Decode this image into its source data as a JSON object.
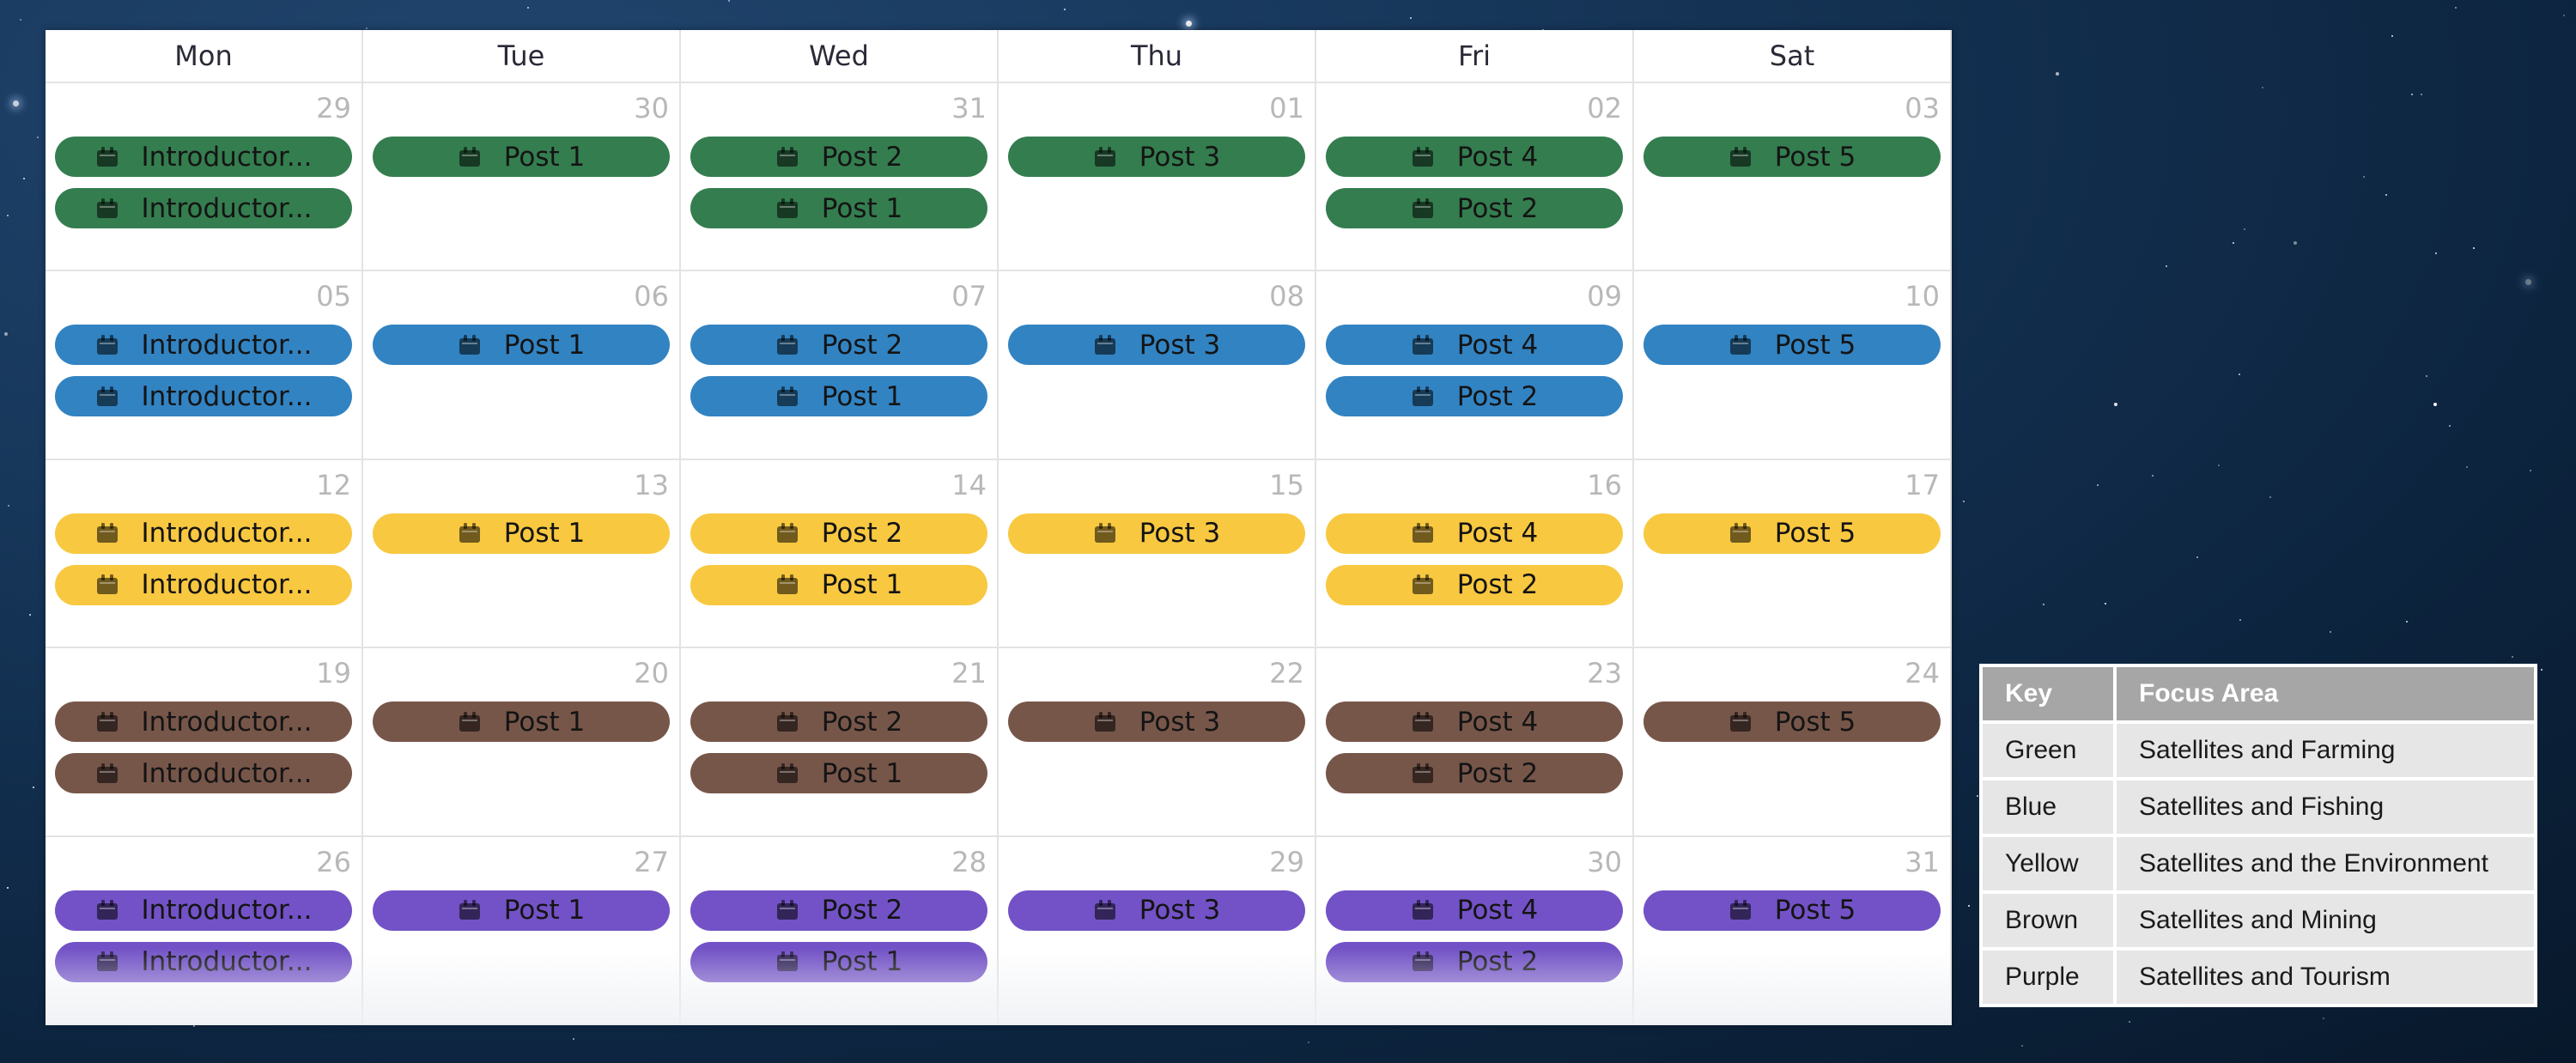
{
  "calendar": {
    "days": [
      "Mon",
      "Tue",
      "Wed",
      "Thu",
      "Fri",
      "Sat"
    ],
    "event_icon": "calendar-event-icon",
    "colors": {
      "green": "#347d4f",
      "blue": "#3283c2",
      "yellow": "#f8c840",
      "brown": "#77564a",
      "purple": "#7252c6"
    },
    "weeks": [
      {
        "color": "green",
        "cells": [
          {
            "date": "29",
            "events": [
              "Introductor...",
              "Introductor..."
            ]
          },
          {
            "date": "30",
            "events": [
              "Post 1"
            ]
          },
          {
            "date": "31",
            "events": [
              "Post 2",
              "Post 1"
            ]
          },
          {
            "date": "01",
            "events": [
              "Post 3"
            ]
          },
          {
            "date": "02",
            "events": [
              "Post 4",
              "Post 2"
            ]
          },
          {
            "date": "03",
            "events": [
              "Post 5"
            ]
          }
        ]
      },
      {
        "color": "blue",
        "cells": [
          {
            "date": "05",
            "events": [
              "Introductor...",
              "Introductor..."
            ]
          },
          {
            "date": "06",
            "events": [
              "Post 1"
            ]
          },
          {
            "date": "07",
            "events": [
              "Post 2",
              "Post 1"
            ]
          },
          {
            "date": "08",
            "events": [
              "Post 3"
            ]
          },
          {
            "date": "09",
            "events": [
              "Post 4",
              "Post 2"
            ]
          },
          {
            "date": "10",
            "events": [
              "Post 5"
            ]
          }
        ]
      },
      {
        "color": "yellow",
        "cells": [
          {
            "date": "12",
            "events": [
              "Introductor...",
              "Introductor..."
            ]
          },
          {
            "date": "13",
            "events": [
              "Post 1"
            ]
          },
          {
            "date": "14",
            "events": [
              "Post 2",
              "Post 1"
            ]
          },
          {
            "date": "15",
            "events": [
              "Post 3"
            ]
          },
          {
            "date": "16",
            "events": [
              "Post 4",
              "Post 2"
            ]
          },
          {
            "date": "17",
            "events": [
              "Post 5"
            ]
          }
        ]
      },
      {
        "color": "brown",
        "cells": [
          {
            "date": "19",
            "events": [
              "Introductor...",
              "Introductor..."
            ]
          },
          {
            "date": "20",
            "events": [
              "Post 1"
            ]
          },
          {
            "date": "21",
            "events": [
              "Post 2",
              "Post 1"
            ]
          },
          {
            "date": "22",
            "events": [
              "Post 3"
            ]
          },
          {
            "date": "23",
            "events": [
              "Post 4",
              "Post 2"
            ]
          },
          {
            "date": "24",
            "events": [
              "Post 5"
            ]
          }
        ]
      },
      {
        "color": "purple",
        "cells": [
          {
            "date": "26",
            "events": [
              "Introductor...",
              "Introductor..."
            ]
          },
          {
            "date": "27",
            "events": [
              "Post 1"
            ]
          },
          {
            "date": "28",
            "events": [
              "Post 2",
              "Post 1"
            ]
          },
          {
            "date": "29",
            "events": [
              "Post 3"
            ]
          },
          {
            "date": "30",
            "events": [
              "Post 4",
              "Post 2"
            ]
          },
          {
            "date": "31",
            "events": [
              "Post 5"
            ]
          }
        ]
      }
    ]
  },
  "key_table": {
    "headers": {
      "key": "Key",
      "focus": "Focus Area"
    },
    "rows": [
      {
        "key": "Green",
        "focus": "Satellites and Farming"
      },
      {
        "key": "Blue",
        "focus": "Satellites and Fishing"
      },
      {
        "key": "Yellow",
        "focus": "Satellites and the Environment"
      },
      {
        "key": "Brown",
        "focus": "Satellites and Mining"
      },
      {
        "key": "Purple",
        "focus": "Satellites and Tourism"
      }
    ]
  }
}
